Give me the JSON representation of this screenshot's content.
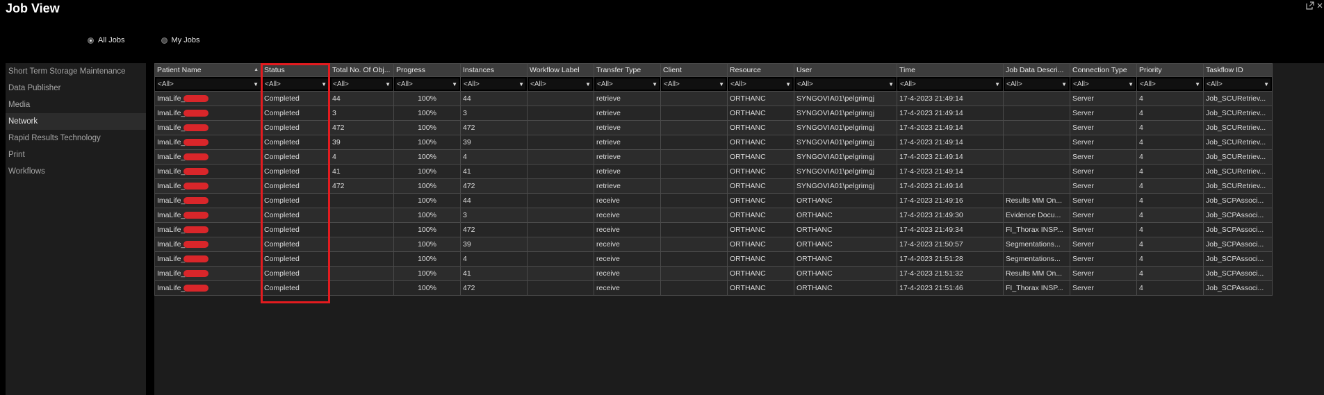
{
  "window": {
    "title": "Job View"
  },
  "filter_mode": {
    "all_jobs": "All Jobs",
    "my_jobs": "My Jobs"
  },
  "sidebar": {
    "items": [
      {
        "label": "Short Term Storage Maintenance"
      },
      {
        "label": "Data Publisher"
      },
      {
        "label": "Media"
      },
      {
        "label": "Network"
      },
      {
        "label": "Rapid Results Technology"
      },
      {
        "label": "Print"
      },
      {
        "label": "Workflows"
      }
    ]
  },
  "table": {
    "columns": [
      "Patient Name",
      "Status",
      "Total No. Of Obj...",
      "Progress",
      "Instances",
      "Workflow Label",
      "Transfer Type",
      "Client",
      "Resource",
      "User",
      "Time",
      "Job Data Descri...",
      "Connection Type",
      "Priority",
      "Taskflow ID"
    ],
    "filter_value": "<All>",
    "rows": [
      {
        "patient": "ImaLife_",
        "status": "Completed",
        "total": "44",
        "progress": "100%",
        "instances": "44",
        "workflow": "",
        "transfer": "retrieve",
        "client": "",
        "resource": "ORTHANC",
        "user": "SYNGOVIA01\\pelgrimgj",
        "time": "17-4-2023 21:49:14",
        "desc": "",
        "conn": "Server",
        "priority": "4",
        "taskflow": "Job_SCURetriev..."
      },
      {
        "patient": "ImaLife_",
        "status": "Completed",
        "total": "3",
        "progress": "100%",
        "instances": "3",
        "workflow": "",
        "transfer": "retrieve",
        "client": "",
        "resource": "ORTHANC",
        "user": "SYNGOVIA01\\pelgrimgj",
        "time": "17-4-2023 21:49:14",
        "desc": "",
        "conn": "Server",
        "priority": "4",
        "taskflow": "Job_SCURetriev..."
      },
      {
        "patient": "ImaLife_",
        "status": "Completed",
        "total": "472",
        "progress": "100%",
        "instances": "472",
        "workflow": "",
        "transfer": "retrieve",
        "client": "",
        "resource": "ORTHANC",
        "user": "SYNGOVIA01\\pelgrimgj",
        "time": "17-4-2023 21:49:14",
        "desc": "",
        "conn": "Server",
        "priority": "4",
        "taskflow": "Job_SCURetriev..."
      },
      {
        "patient": "ImaLife_",
        "status": "Completed",
        "total": "39",
        "progress": "100%",
        "instances": "39",
        "workflow": "",
        "transfer": "retrieve",
        "client": "",
        "resource": "ORTHANC",
        "user": "SYNGOVIA01\\pelgrimgj",
        "time": "17-4-2023 21:49:14",
        "desc": "",
        "conn": "Server",
        "priority": "4",
        "taskflow": "Job_SCURetriev..."
      },
      {
        "patient": "ImaLife_",
        "status": "Completed",
        "total": "4",
        "progress": "100%",
        "instances": "4",
        "workflow": "",
        "transfer": "retrieve",
        "client": "",
        "resource": "ORTHANC",
        "user": "SYNGOVIA01\\pelgrimgj",
        "time": "17-4-2023 21:49:14",
        "desc": "",
        "conn": "Server",
        "priority": "4",
        "taskflow": "Job_SCURetriev..."
      },
      {
        "patient": "ImaLife_",
        "status": "Completed",
        "total": "41",
        "progress": "100%",
        "instances": "41",
        "workflow": "",
        "transfer": "retrieve",
        "client": "",
        "resource": "ORTHANC",
        "user": "SYNGOVIA01\\pelgrimgj",
        "time": "17-4-2023 21:49:14",
        "desc": "",
        "conn": "Server",
        "priority": "4",
        "taskflow": "Job_SCURetriev..."
      },
      {
        "patient": "ImaLife_",
        "status": "Completed",
        "total": "472",
        "progress": "100%",
        "instances": "472",
        "workflow": "",
        "transfer": "retrieve",
        "client": "",
        "resource": "ORTHANC",
        "user": "SYNGOVIA01\\pelgrimgj",
        "time": "17-4-2023 21:49:14",
        "desc": "",
        "conn": "Server",
        "priority": "4",
        "taskflow": "Job_SCURetriev..."
      },
      {
        "patient": "ImaLife_",
        "status": "Completed",
        "total": "",
        "progress": "100%",
        "instances": "44",
        "workflow": "",
        "transfer": "receive",
        "client": "",
        "resource": "ORTHANC",
        "user": "ORTHANC",
        "time": "17-4-2023 21:49:16",
        "desc": "Results MM On...",
        "conn": "Server",
        "priority": "4",
        "taskflow": "Job_SCPAssoci..."
      },
      {
        "patient": "ImaLife_",
        "status": "Completed",
        "total": "",
        "progress": "100%",
        "instances": "3",
        "workflow": "",
        "transfer": "receive",
        "client": "",
        "resource": "ORTHANC",
        "user": "ORTHANC",
        "time": "17-4-2023 21:49:30",
        "desc": "Evidence Docu...",
        "conn": "Server",
        "priority": "4",
        "taskflow": "Job_SCPAssoci..."
      },
      {
        "patient": "ImaLife_",
        "status": "Completed",
        "total": "",
        "progress": "100%",
        "instances": "472",
        "workflow": "",
        "transfer": "receive",
        "client": "",
        "resource": "ORTHANC",
        "user": "ORTHANC",
        "time": "17-4-2023 21:49:34",
        "desc": "FI_Thorax INSP...",
        "conn": "Server",
        "priority": "4",
        "taskflow": "Job_SCPAssoci..."
      },
      {
        "patient": "ImaLife_",
        "status": "Completed",
        "total": "",
        "progress": "100%",
        "instances": "39",
        "workflow": "",
        "transfer": "receive",
        "client": "",
        "resource": "ORTHANC",
        "user": "ORTHANC",
        "time": "17-4-2023 21:50:57",
        "desc": "Segmentations...",
        "conn": "Server",
        "priority": "4",
        "taskflow": "Job_SCPAssoci..."
      },
      {
        "patient": "ImaLife_",
        "status": "Completed",
        "total": "",
        "progress": "100%",
        "instances": "4",
        "workflow": "",
        "transfer": "receive",
        "client": "",
        "resource": "ORTHANC",
        "user": "ORTHANC",
        "time": "17-4-2023 21:51:28",
        "desc": "Segmentations...",
        "conn": "Server",
        "priority": "4",
        "taskflow": "Job_SCPAssoci..."
      },
      {
        "patient": "ImaLife_",
        "status": "Completed",
        "total": "",
        "progress": "100%",
        "instances": "41",
        "workflow": "",
        "transfer": "receive",
        "client": "",
        "resource": "ORTHANC",
        "user": "ORTHANC",
        "time": "17-4-2023 21:51:32",
        "desc": "Results MM On...",
        "conn": "Server",
        "priority": "4",
        "taskflow": "Job_SCPAssoci..."
      },
      {
        "patient": "ImaLife_",
        "status": "Completed",
        "total": "",
        "progress": "100%",
        "instances": "472",
        "workflow": "",
        "transfer": "receive",
        "client": "",
        "resource": "ORTHANC",
        "user": "ORTHANC",
        "time": "17-4-2023 21:51:46",
        "desc": "FI_Thorax INSP...",
        "conn": "Server",
        "priority": "4",
        "taskflow": "Job_SCPAssoci..."
      }
    ]
  },
  "colors": {
    "highlight": "#e31b1f",
    "redaction": "#d9262a"
  },
  "icons": [
    "popout-icon",
    "close-icon",
    "sort-ascending-icon",
    "dropdown-caret-icon"
  ]
}
